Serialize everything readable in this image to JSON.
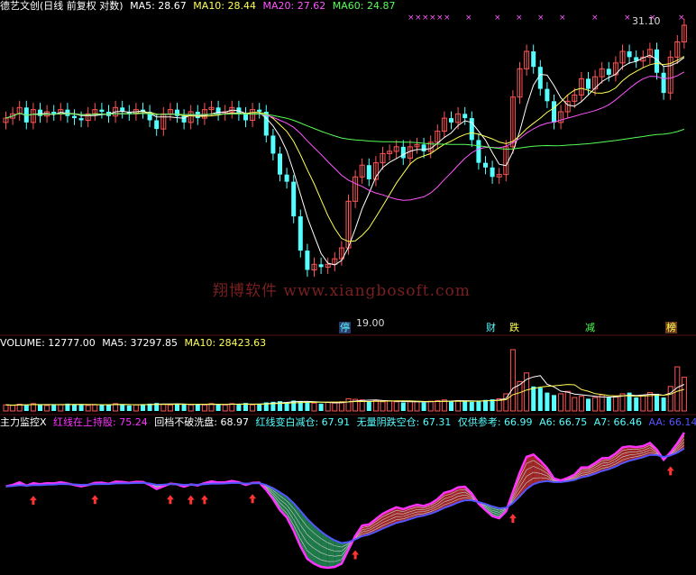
{
  "header": {
    "title": "德艺文创(日线 前复权 对数)",
    "ma5": "MA5: 28.67",
    "ma10": "MA10: 28.44",
    "ma20": "MA20: 27.62",
    "ma60": "MA60: 24.87"
  },
  "price_labels": {
    "high": "31.10",
    "low": "19.00"
  },
  "event_tags": [
    {
      "id": "ting",
      "text": "停",
      "color": "#55ffff"
    },
    {
      "id": "cai",
      "text": "财",
      "color": "#55ffff"
    },
    {
      "id": "die",
      "text": "跌",
      "color": "#ffff55"
    },
    {
      "id": "jian",
      "text": "减",
      "color": "#55ff55"
    },
    {
      "id": "bang",
      "text": "榜",
      "color": "#ffff55"
    }
  ],
  "watermark": "翔博软件 www.xiangbosoft.com",
  "volume_header": {
    "label": "VOLUME: 12777.00",
    "ma5": "MA5: 37297.85",
    "ma10": "MA10: 28423.63"
  },
  "indicator_header": {
    "name": "主力监控X",
    "l1": "红线在上持股: 75.24",
    "l2": "回档不破洗盘: 68.97",
    "l3": "红线变白减仓: 67.91",
    "l4": "无量阴跌空仓: 67.31",
    "l5": "仅供参考: 66.99",
    "a6": "A6: 66.75",
    "a7": "A7: 66.46",
    "aa": "AA: 66.14"
  },
  "colors": {
    "bg": "#000000",
    "up": "#ff5555",
    "down": "#55ffff",
    "ma5": "#ffffff",
    "ma10": "#ffff55",
    "ma20": "#ff55ff",
    "ma60": "#55ff55",
    "title": "#cccccc",
    "fill_up": "#a02828",
    "fill_down": "#1f7a4a",
    "blue": "#5555ff",
    "pink": "#ff33ff"
  },
  "chart_data": {
    "type": "candlestick",
    "closes": [
      26.4,
      26.6,
      26.9,
      26.2,
      26.8,
      26.5,
      26.7,
      26.6,
      26.8,
      26.5,
      26.4,
      26.3,
      26.6,
      26.8,
      26.7,
      26.5,
      26.9,
      26.7,
      26.6,
      26.8,
      26.7,
      26.3,
      25.9,
      26.6,
      26.8,
      26.5,
      26.2,
      26.7,
      26.4,
      26.8,
      26.9,
      26.6,
      26.7,
      26.9,
      26.6,
      26.3,
      26.8,
      26.7,
      25.6,
      24.8,
      23.9,
      23.6,
      22.2,
      20.9,
      20.2,
      20.4,
      20.3,
      20.4,
      20.6,
      21.0,
      22.8,
      23.8,
      24.3,
      23.7,
      24.4,
      24.8,
      24.9,
      25.1,
      24.6,
      25.1,
      25.2,
      24.9,
      25.3,
      25.8,
      26.4,
      26.2,
      26.6,
      26.4,
      25.4,
      24.4,
      24.2,
      23.8,
      23.9,
      25.1,
      27.4,
      28.8,
      29.7,
      28.9,
      27.8,
      27.2,
      26.2,
      26.7,
      27.2,
      27.5,
      28.3,
      27.8,
      28.4,
      28.8,
      28.5,
      29.1,
      29.7,
      29.4,
      29.2,
      29.4,
      29.8,
      28.6,
      27.6,
      29.4,
      30.2,
      31.1
    ],
    "volumes": [
      0.1,
      0.09,
      0.11,
      0.1,
      0.12,
      0.1,
      0.09,
      0.11,
      0.1,
      0.12,
      0.11,
      0.1,
      0.09,
      0.1,
      0.11,
      0.1,
      0.12,
      0.1,
      0.09,
      0.1,
      0.11,
      0.12,
      0.13,
      0.11,
      0.1,
      0.12,
      0.11,
      0.1,
      0.11,
      0.1,
      0.12,
      0.11,
      0.1,
      0.12,
      0.11,
      0.13,
      0.1,
      0.11,
      0.14,
      0.15,
      0.16,
      0.14,
      0.17,
      0.16,
      0.15,
      0.13,
      0.12,
      0.14,
      0.13,
      0.15,
      0.2,
      0.19,
      0.18,
      0.16,
      0.17,
      0.15,
      0.16,
      0.15,
      0.14,
      0.16,
      0.15,
      0.14,
      0.16,
      0.17,
      0.18,
      0.16,
      0.17,
      0.16,
      0.15,
      0.17,
      0.18,
      0.19,
      0.2,
      0.28,
      1.0,
      0.48,
      0.62,
      0.4,
      0.38,
      0.3,
      0.26,
      0.28,
      0.32,
      0.22,
      0.24,
      0.2,
      0.22,
      0.26,
      0.22,
      0.24,
      0.28,
      0.3,
      0.22,
      0.26,
      0.3,
      0.28,
      0.22,
      0.4,
      0.72,
      0.55
    ]
  }
}
